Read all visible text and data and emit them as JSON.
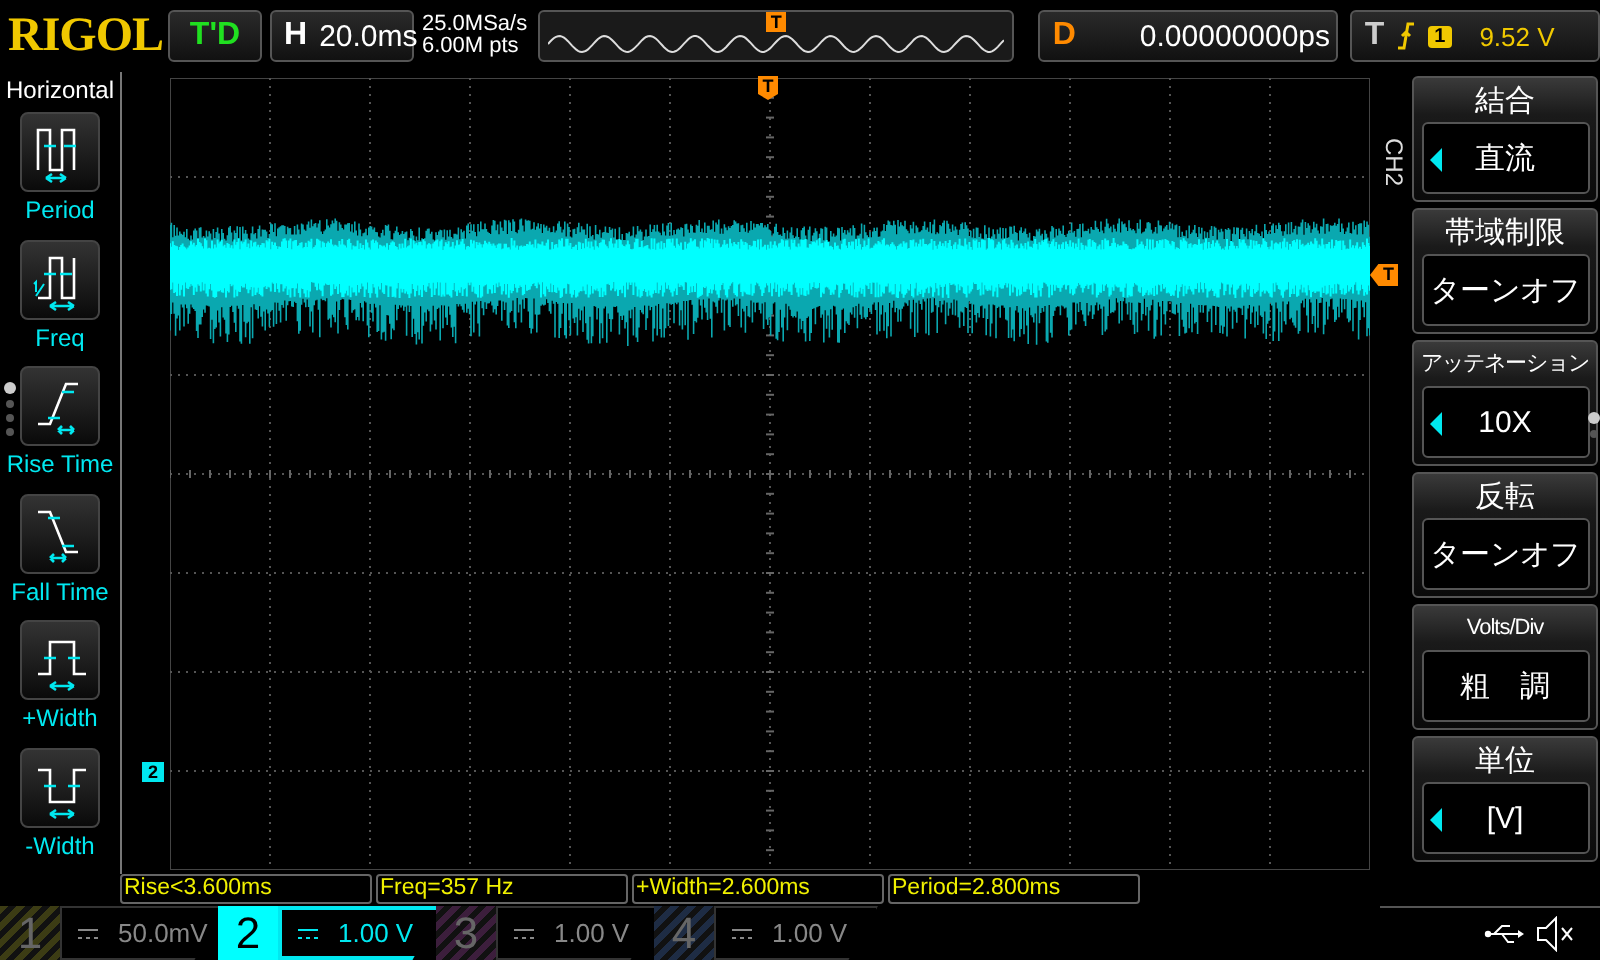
{
  "header": {
    "logo": "RIGOL",
    "run_state": "T'D",
    "horizontal": {
      "label": "H",
      "value": "20.0ms"
    },
    "sample_rate": "25.0MSa/s",
    "memory_depth": "6.00M pts",
    "overview_trigger": "T",
    "delay": {
      "label": "D",
      "value": "0.00000000ps"
    },
    "trigger": {
      "label": "T",
      "source": "1",
      "level": "9.52 V"
    }
  },
  "left_menu": {
    "title": "Horizontal",
    "items": [
      {
        "label": "Period",
        "kind": "period"
      },
      {
        "label": "Freq",
        "kind": "freq"
      },
      {
        "label": "Rise Time",
        "kind": "rise"
      },
      {
        "label": "Fall Time",
        "kind": "fall"
      },
      {
        "label": "+Width",
        "kind": "pwidth"
      },
      {
        "label": "-Width",
        "kind": "nwidth"
      }
    ],
    "pages": [
      {
        "selected": true
      },
      {
        "selected": false
      },
      {
        "selected": false
      },
      {
        "selected": false
      }
    ]
  },
  "screen": {
    "trigger_position_marker": "T",
    "trigger_level_marker": "T",
    "channel_marker": "2"
  },
  "right_menu": {
    "channel": "CH2",
    "items": [
      {
        "title": "結合",
        "value": "直流",
        "has_arrow": true
      },
      {
        "title": "帯域制限",
        "value": "ターンオフ",
        "has_arrow": false
      },
      {
        "title": "アッテネーション",
        "value": "10X",
        "has_arrow": true
      },
      {
        "title": "反転",
        "value": "ターンオフ",
        "has_arrow": false
      },
      {
        "title": "Volts/Div",
        "value": "粗　調",
        "has_arrow": false
      },
      {
        "title": "単位",
        "value": "[V]",
        "has_arrow": true
      }
    ],
    "pages": [
      {
        "selected": true
      },
      {
        "selected": false
      }
    ]
  },
  "measurements": [
    "Rise<3.600ms",
    "Freq=357 Hz",
    "+Width=2.600ms",
    "Period=2.800ms"
  ],
  "channels": [
    {
      "number": "1",
      "value": "50.0mV",
      "selected": false,
      "color": "#3c3c14"
    },
    {
      "number": "2",
      "value": "1.00 V",
      "selected": true,
      "color": "#00ffff"
    },
    {
      "number": "3",
      "value": "1.00 V",
      "selected": false,
      "color": "#3c1e3c"
    },
    {
      "number": "4",
      "value": "1.00 V",
      "selected": false,
      "color": "#1e2c44"
    }
  ]
}
